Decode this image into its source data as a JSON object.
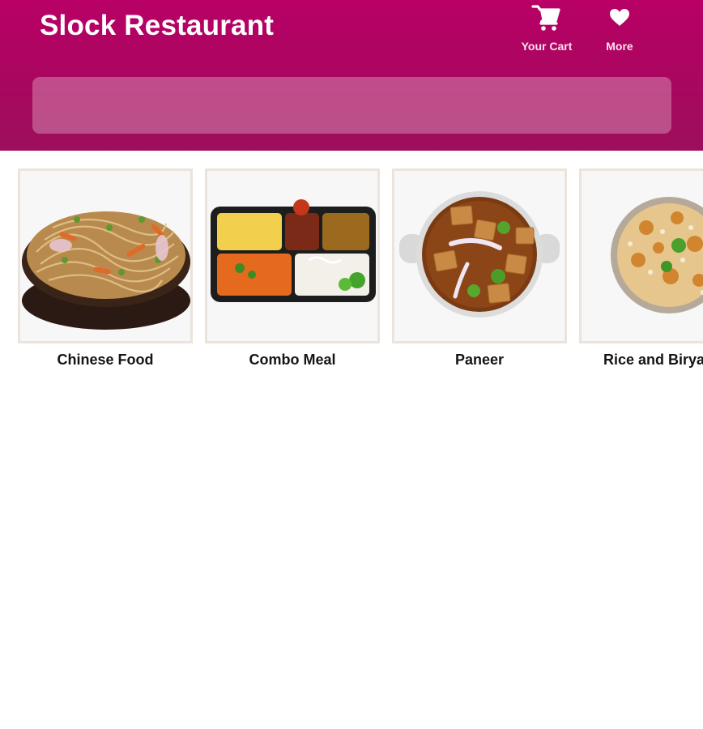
{
  "header": {
    "title": "Slock Restaurant",
    "cart_label": "Your Cart",
    "cart_icon": "cart-icon",
    "more_label": "More",
    "more_icon": "heart-icon"
  },
  "search": {
    "placeholder": "",
    "value": ""
  },
  "categories": [
    {
      "label": "Chinese Food",
      "image": "noodles-bowl-image"
    },
    {
      "label": "Combo Meal",
      "image": "combo-tray-image"
    },
    {
      "label": "Paneer",
      "image": "paneer-curry-image"
    },
    {
      "label": "Rice and Biryani",
      "image": "biryani-bowl-image"
    }
  ],
  "colors": {
    "header_top": "#b80066",
    "header_bottom": "#9d0f5c",
    "card_border": "#ece4dc"
  }
}
